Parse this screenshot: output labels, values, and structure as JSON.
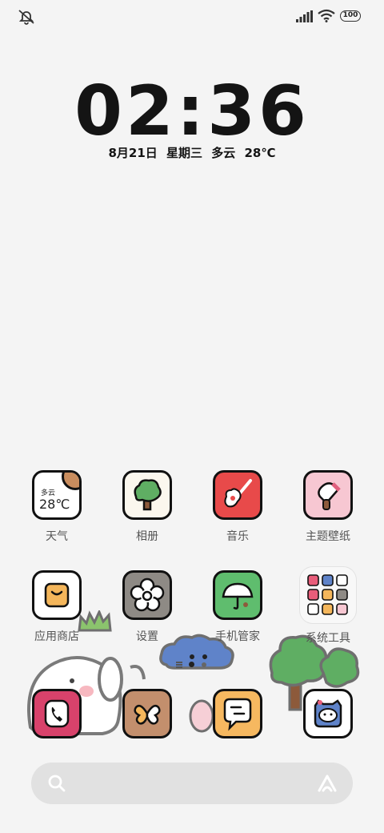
{
  "status_bar": {
    "left_icon": "mute-vibrate-icon",
    "signal_icon": "signal-bars-icon",
    "wifi_icon": "wifi-icon",
    "battery_level": "100"
  },
  "lockclock": {
    "time": "02:36",
    "date_line": "8月21日  星期三  多云  28℃"
  },
  "apps_row1": [
    {
      "label": "天气",
      "widget_condition": "多云",
      "widget_temp": "28℃",
      "icon": "weather-icon"
    },
    {
      "label": "相册",
      "icon": "gallery-tree-icon"
    },
    {
      "label": "音乐",
      "icon": "music-guitar-icon"
    },
    {
      "label": "主题壁纸",
      "icon": "theme-brush-icon"
    }
  ],
  "apps_row2": [
    {
      "label": "应用商店",
      "icon": "app-store-bag-icon"
    },
    {
      "label": "设置",
      "icon": "settings-flower-icon"
    },
    {
      "label": "手机管家",
      "icon": "phone-manager-umbrella-icon"
    },
    {
      "label": "系统工具",
      "icon": "system-tools-folder-icon"
    }
  ],
  "dock": [
    {
      "icon": "phone-icon"
    },
    {
      "icon": "messages-butterfly-icon"
    },
    {
      "icon": "chat-bubble-icon"
    },
    {
      "icon": "camera-cat-icon"
    }
  ],
  "search": {
    "icon": "search-icon",
    "assistant_icon": "assistant-icon"
  },
  "colors": {
    "background": "#f4f4f4",
    "music": "#e84a4a",
    "theme": "#f7c7d2",
    "manager": "#5fbd6e",
    "store": "#f4b65b",
    "settings": "#8e8a85",
    "phone": "#d8426b",
    "messages": "#c38f6d",
    "chat": "#f6b860"
  }
}
